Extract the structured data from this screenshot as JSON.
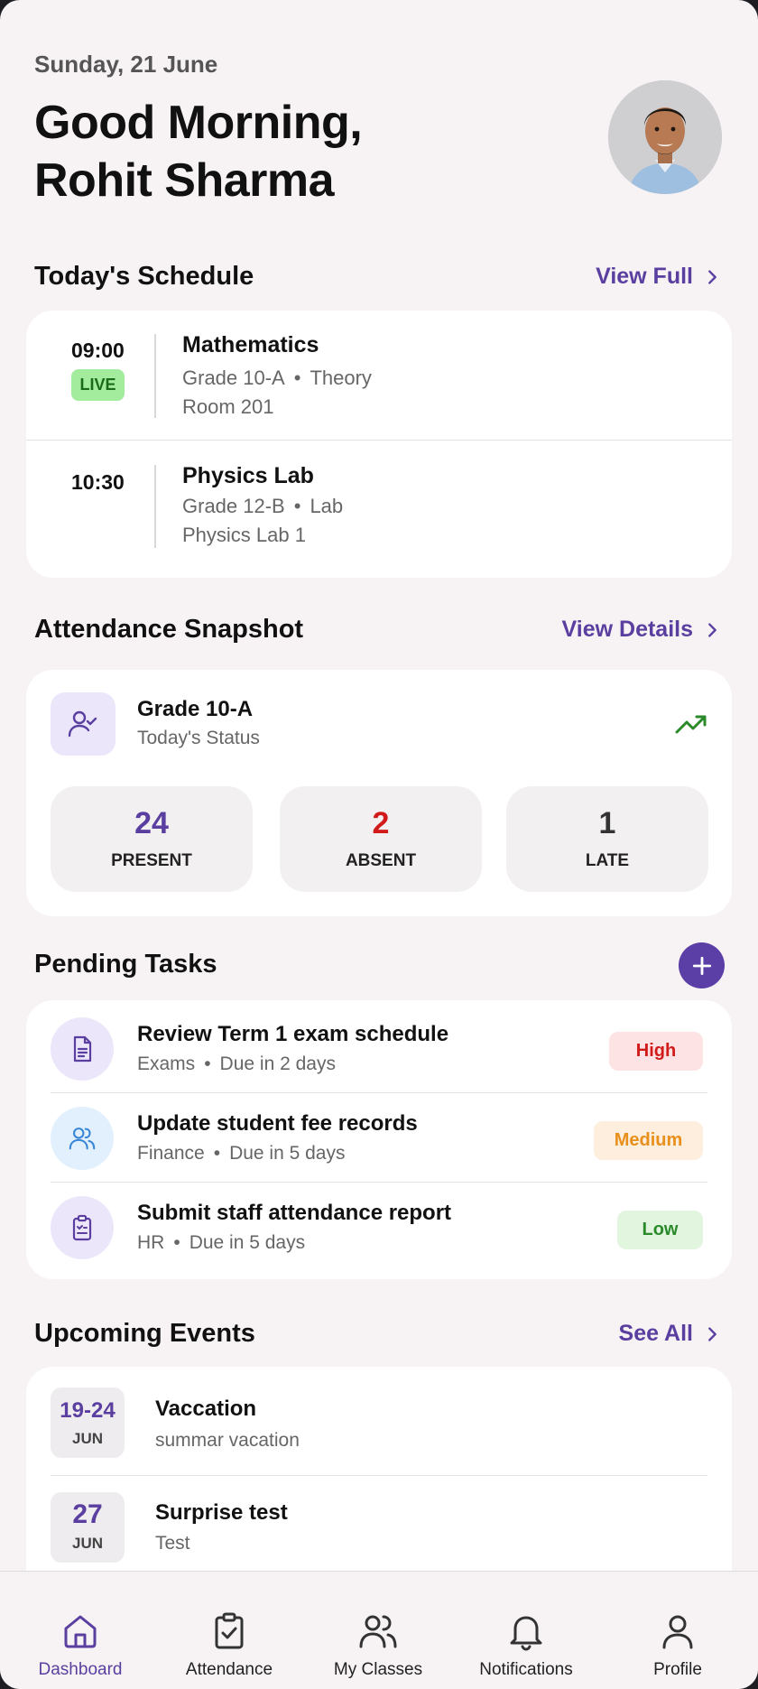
{
  "header": {
    "date": "Sunday, 21 June",
    "greeting_line1": "Good Morning,",
    "greeting_line2": "Rohit Sharma"
  },
  "schedule": {
    "title": "Today's Schedule",
    "link": "View Full",
    "items": [
      {
        "time": "09:00",
        "live": "LIVE",
        "subject": "Mathematics",
        "grade": "Grade 10-A",
        "type": "Theory",
        "room": "Room 201"
      },
      {
        "time": "10:30",
        "subject": "Physics Lab",
        "grade": "Grade 12-B",
        "type": "Lab",
        "room": "Physics Lab 1"
      }
    ]
  },
  "attendance": {
    "title": "Attendance Snapshot",
    "link": "View Details",
    "class": "Grade 10-A",
    "status": "Today's Status",
    "stats": [
      {
        "value": "24",
        "label": "PRESENT",
        "color": "#5a3fa0"
      },
      {
        "value": "2",
        "label": "ABSENT",
        "color": "#d11a1a"
      },
      {
        "value": "1",
        "label": "LATE",
        "color": "#333333"
      }
    ]
  },
  "tasks": {
    "title": "Pending Tasks",
    "items": [
      {
        "icon": "document-icon",
        "title": "Review Term 1 exam schedule",
        "category": "Exams",
        "due": "Due in 2 days",
        "priority": "High"
      },
      {
        "icon": "users-icon",
        "title": "Update student fee records",
        "category": "Finance",
        "due": "Due in 5 days",
        "priority": "Medium"
      },
      {
        "icon": "clipboard-icon",
        "title": "Submit staff attendance report",
        "category": "HR",
        "due": "Due in 5 days",
        "priority": "Low"
      }
    ]
  },
  "events": {
    "title": "Upcoming Events",
    "link": "See All",
    "items": [
      {
        "day": "19-24",
        "month": "JUN",
        "title": "Vaccation",
        "subtitle": "summar vacation"
      },
      {
        "day": "27",
        "month": "JUN",
        "title": "Surprise test",
        "subtitle": "Test"
      }
    ]
  },
  "nav": {
    "items": [
      {
        "label": "Dashboard",
        "icon": "home-icon",
        "active": true
      },
      {
        "label": "Attendance",
        "icon": "clipboard-check-icon"
      },
      {
        "label": "My Classes",
        "icon": "users-icon"
      },
      {
        "label": "Notifications",
        "icon": "bell-icon"
      },
      {
        "label": "Profile",
        "icon": "person-icon"
      }
    ]
  },
  "colors": {
    "accent": "#5a3fa0",
    "high": "#d11a1a",
    "medium": "#e8901b",
    "low": "#2a8a2a"
  }
}
